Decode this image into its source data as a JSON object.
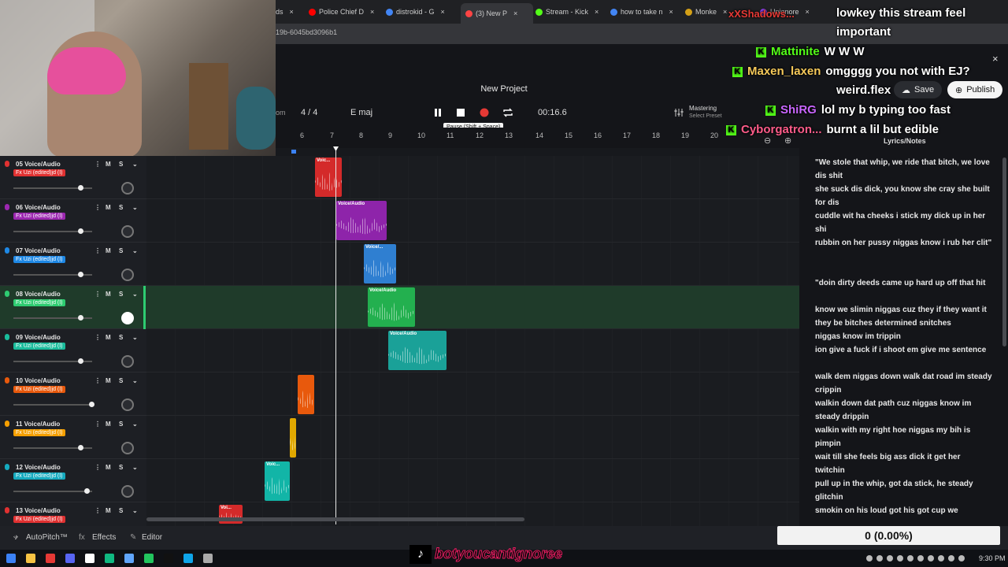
{
  "browser": {
    "tabs": [
      {
        "label": "ds",
        "color": "#888"
      },
      {
        "label": "Police Chief D",
        "color": "#ff0000"
      },
      {
        "label": "distrokid - G",
        "color": "#4285f4"
      },
      {
        "label": "(3) New P",
        "color": "#ff4444"
      },
      {
        "label": "Stream - Kick",
        "color": "#53fc18"
      },
      {
        "label": "how to take n",
        "color": "#4285f4"
      },
      {
        "label": "Monke",
        "color": "#d4a017"
      },
      {
        "label": "Unignore",
        "color": "#9146ff"
      }
    ],
    "url": "19b-6045bd3096b1"
  },
  "app": {
    "project_title": "New Project",
    "time_signature": "4 / 4",
    "key": "E maj",
    "time": "00:16.6",
    "tooltip": "Pause (Shift + Space)",
    "mastering_label": "Mastering",
    "mastering_sub": "Select Preset",
    "save_label": "Save",
    "publish_label": "Publish",
    "left_partial": "om",
    "bar_numbers": [
      "6",
      "7",
      "8",
      "9",
      "10",
      "11",
      "12",
      "13",
      "14",
      "15",
      "16",
      "17",
      "18",
      "19",
      "20"
    ]
  },
  "tracks": [
    {
      "name": "05 Voice/Audio",
      "fx": "Fx Uzi (edited)jd (I)",
      "color": "#e03131",
      "knob": 0.85
    },
    {
      "name": "06 Voice/Audio",
      "fx": "Fx Uzi (edited)jd (I)",
      "color": "#9c27b0",
      "knob": 0.85
    },
    {
      "name": "07 Voice/Audio",
      "fx": "Fx Uzi (edited)jd (I)",
      "color": "#1e88e5",
      "knob": 0.85
    },
    {
      "name": "08 Voice/Audio",
      "fx": "Fx Uzi (edited)jd (I)",
      "color": "#2ecc71",
      "knob": 0.85
    },
    {
      "name": "09 Voice/Audio",
      "fx": "Fx Uzi (edited)jd (I)",
      "color": "#1abc9c",
      "knob": 0.85
    },
    {
      "name": "10 Voice/Audio",
      "fx": "Fx Uzi (edited)jd (I)",
      "color": "#e8590c",
      "knob": 0.99
    },
    {
      "name": "11 Voice/Audio",
      "fx": "Fx Uzi (edited)jd (I)",
      "color": "#f59f00",
      "knob": 0.85
    },
    {
      "name": "12 Voice/Audio",
      "fx": "Fx Uzi (edited)jd (I)",
      "color": "#15aabf",
      "knob": 0.93
    },
    {
      "name": "13 Voice/Audio",
      "fx": "Fx Uzi (edited)jd (I)",
      "color": "#e03131",
      "knob": 0.85
    }
  ],
  "track_buttons": {
    "mute": "M",
    "solo": "S"
  },
  "clips": [
    {
      "label": "Voic...",
      "color": "#d42a2a"
    },
    {
      "label": "Voice/Audio",
      "color": "#8e24aa"
    },
    {
      "label": "Voice/...",
      "color": "#2f7fd1"
    },
    {
      "label": "Voice/Audio",
      "color": "#23b04f"
    },
    {
      "label": "Voice/Audio",
      "color": "#1aa198"
    },
    {
      "label": "",
      "color": "#e8590c"
    },
    {
      "label": "",
      "color": "#e0a800"
    },
    {
      "label": "Voic...",
      "color": "#12b5a7"
    },
    {
      "label": "Voi...",
      "color": "#d42a2a"
    }
  ],
  "lyrics": {
    "title": "Lyrics/Notes",
    "lines": [
      "\"We stole that whip, we ride that bitch, we love dis shit",
      "she suck dis dick, you know she cray she built for dis",
      "cuddle wit ha cheeks i stick my dick up in her shi",
      "rubbin on her pussy niggas know i rub her clit\"",
      "",
      "\"doin dirty deeds came up hard up off that hit",
      "know we slimin niggas cuz they if they want it they be bitches determined snitches",
      "niggas know im trippin",
      "ion give a fuck if i shoot em give me sentence",
      "walk dem niggas down walk dat road im steady crippin",
      "walkin down dat path cuz niggas know im steady drippin",
      "walkin with my right hoe niggas my bih is pimpin",
      "wait till she feels big ass dick it get her twitchin",
      "pull up in the whip, got da stick, he steady glitchin",
      "smokin on his loud got his got cup we"
    ]
  },
  "chat": [
    {
      "user": "",
      "msg": "lowkey this stream feel",
      "user_color": "#ffffff"
    },
    {
      "user": "",
      "msg": "important",
      "user_color": "#ffffff"
    },
    {
      "user": "Mattinite",
      "msg": "W W W",
      "user_color": "#53fc18"
    },
    {
      "user": "Maxen_laxen",
      "msg": "omgggg you not with EJ?",
      "user_color": "#f6c95a"
    },
    {
      "user": "",
      "msg": "weird.flex",
      "user_color": "#ffffff"
    },
    {
      "user": "ShiRG",
      "msg": "lol my b typing too fast",
      "user_color": "#c966ff"
    },
    {
      "user": "Cyborgatron...",
      "msg": "burnt a lil but edible",
      "user_color": "#ff5c8a"
    }
  ],
  "chat_header_user": "xXShadows...",
  "bottom": {
    "autopitch": "AutoPitch™",
    "effects": "Effects",
    "editor": "Editor",
    "sub_counter": "0 (0.00%)",
    "handle": "botyoucantignoree",
    "clock": "9:30 PM"
  }
}
